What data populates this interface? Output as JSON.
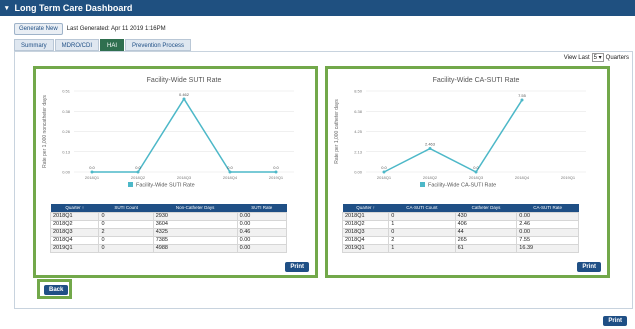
{
  "app": {
    "title": "Long Term Care Dashboard"
  },
  "toolbar": {
    "generate_label": "Generate New",
    "last_generated": "Last Generated: Apr 11 2019 1:16PM"
  },
  "tabs": [
    {
      "label": "Summary",
      "active": false
    },
    {
      "label": "MDRO/CDI",
      "active": false
    },
    {
      "label": "HAI",
      "active": true
    },
    {
      "label": "Prevention Process",
      "active": false
    }
  ],
  "view": {
    "prefix": "View Last",
    "value": "5",
    "suffix": "Quarters"
  },
  "buttons": {
    "print_label": "Print",
    "back_label": "Back"
  },
  "colors": {
    "header": "#1f5080",
    "accent_green": "#72a84a",
    "line": "#4db8c8",
    "table_header": "#1f4f85"
  },
  "chart_data": [
    {
      "type": "line",
      "title": "Facility-Wide SUTI Rate",
      "ylabel": "Rate per 1,000 noncatheter days",
      "categories": [
        "2018Q1",
        "2018Q2",
        "2018Q3",
        "2018Q4",
        "2019Q1"
      ],
      "values": [
        0,
        0,
        0.46,
        0,
        0
      ],
      "labels": [
        "0.0",
        "0.0",
        "0.462",
        "0.0",
        "0.0"
      ],
      "ylim": [
        0,
        0.51
      ],
      "yticks": [
        "0.00",
        "0.13",
        "0.26",
        "0.38",
        "0.51"
      ],
      "legend": "Facility-Wide SUTI Rate",
      "table": {
        "headers": [
          "Quarter ↑",
          "SUTI Count",
          "Non-Catheter Days",
          "SUTI Rate"
        ],
        "rows": [
          [
            "2018Q1",
            "0",
            "2930",
            "0.00"
          ],
          [
            "2018Q2",
            "0",
            "3604",
            "0.00"
          ],
          [
            "2018Q3",
            "2",
            "4325",
            "0.46"
          ],
          [
            "2018Q4",
            "0",
            "7385",
            "0.00"
          ],
          [
            "2019Q1",
            "0",
            "4988",
            "0.00"
          ]
        ]
      }
    },
    {
      "type": "line",
      "title": "Facility-Wide CA-SUTI Rate",
      "ylabel": "Rate per 1,000 catheter days",
      "categories": [
        "2018Q1",
        "2018Q2",
        "2018Q3",
        "2018Q4",
        "2019Q1"
      ],
      "values": [
        0,
        2.46,
        0,
        7.55,
        null
      ],
      "labels": [
        "0.0",
        "2.463",
        "0.0",
        "7.55"
      ],
      "ylim": [
        0,
        8.5
      ],
      "yticks": [
        "0.00",
        "2.13",
        "4.25",
        "6.38",
        "8.50"
      ],
      "legend": "Facility-Wide CA-SUTI Rate",
      "table": {
        "headers": [
          "Quarter ↑",
          "CA-SUTI Count",
          "Catheter Days",
          "CA-SUTI Rate"
        ],
        "rows": [
          [
            "2018Q1",
            "0",
            "430",
            "0.00"
          ],
          [
            "2018Q2",
            "1",
            "406",
            "2.46"
          ],
          [
            "2018Q3",
            "0",
            "44",
            "0.00"
          ],
          [
            "2018Q4",
            "2",
            "265",
            "7.55"
          ],
          [
            "2019Q1",
            "1",
            "61",
            "16.39"
          ]
        ]
      }
    }
  ]
}
